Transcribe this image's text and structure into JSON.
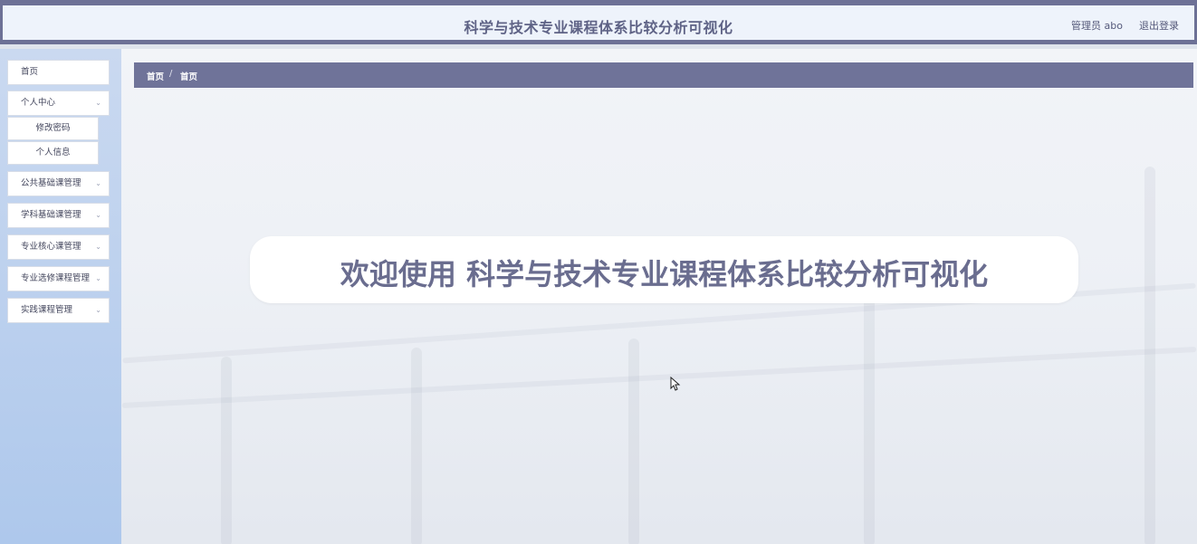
{
  "header": {
    "title": "科学与技术专业课程体系比较分析可视化",
    "user_label": "管理员 abo",
    "logout_label": "退出登录"
  },
  "sidebar": {
    "items": [
      {
        "label": "首页"
      },
      {
        "label": "个人中心",
        "expanded": true,
        "children": [
          {
            "label": "修改密码"
          },
          {
            "label": "个人信息"
          }
        ]
      },
      {
        "label": "公共基础课管理"
      },
      {
        "label": "学科基础课管理"
      },
      {
        "label": "专业核心课管理"
      },
      {
        "label": "专业选修课程管理"
      },
      {
        "label": "实践课程管理"
      }
    ]
  },
  "breadcrumb": {
    "home": "首页",
    "separator": "/",
    "current": "首页"
  },
  "welcome": {
    "text": "欢迎使用 科学与技术专业课程体系比较分析可视化"
  },
  "colors": {
    "accent": "#6d7196",
    "header_bg": "#eef3fb",
    "sidebar_bg": "#aec8ec",
    "welcome_text": "#6a6d8f"
  },
  "icons": {
    "chevron": "chevron-down-icon",
    "cursor": "mouse-pointer-icon"
  }
}
